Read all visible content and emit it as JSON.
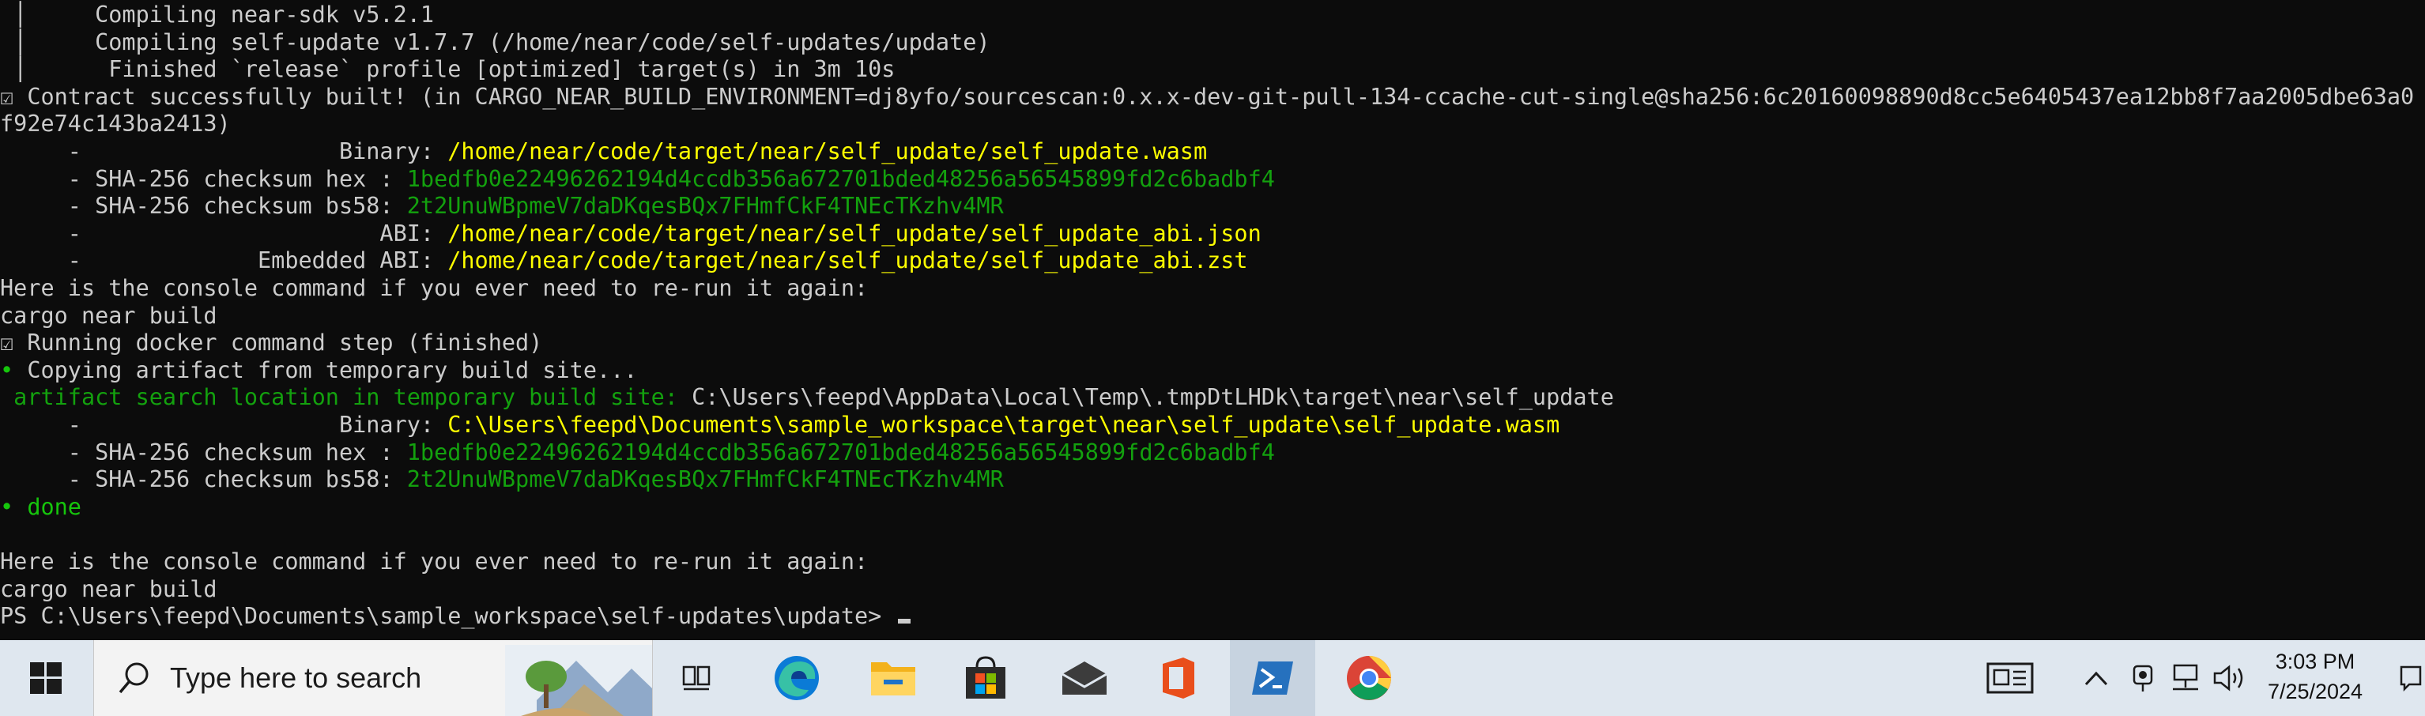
{
  "terminal": {
    "lines": [
      [
        {
          "t": " │     Compiling near-sdk v5.2.1",
          "c": "w"
        }
      ],
      [
        {
          "t": " │     Compiling self-update v1.7.7 (/home/near/code/self-updates/update)",
          "c": "w"
        }
      ],
      [
        {
          "t": " │      Finished `release` profile [optimized] target(s) in 3m 10s",
          "c": "w"
        }
      ],
      [
        {
          "t": "☑ Contract successfully built! (in CARGO_NEAR_BUILD_ENVIRONMENT=dj8yfo/sourcescan:0.x.x-dev-git-pull-134-ccache-cut-single@sha256:6c20160098890d8cc5e6405437ea12bb8f7aa2005dbe63a0",
          "c": "w"
        }
      ],
      [
        {
          "t": "f92e74c143ba2413)",
          "c": "w"
        }
      ],
      [
        {
          "t": "     -                   Binary: ",
          "c": "w"
        },
        {
          "t": "/home/near/code/target/near/self_update/self_update.wasm",
          "c": "y"
        }
      ],
      [
        {
          "t": "     - SHA-256 checksum hex : ",
          "c": "w"
        },
        {
          "t": "1bedfb0e22496262194d4ccdb356a672701bded48256a56545899fd2c6badbf4",
          "c": "dg"
        }
      ],
      [
        {
          "t": "     - SHA-256 checksum bs58: ",
          "c": "w"
        },
        {
          "t": "2t2UnuWBpmeV7daDKqesBQx7FHmfCkF4TNEcTKzhv4MR",
          "c": "dg"
        }
      ],
      [
        {
          "t": "     -                      ABI: ",
          "c": "w"
        },
        {
          "t": "/home/near/code/target/near/self_update/self_update_abi.json",
          "c": "y"
        }
      ],
      [
        {
          "t": "     -             Embedded ABI: ",
          "c": "w"
        },
        {
          "t": "/home/near/code/target/near/self_update/self_update_abi.zst",
          "c": "y"
        }
      ],
      [
        {
          "t": "Here is the console command if you ever need to re-run it again:",
          "c": "w"
        }
      ],
      [
        {
          "t": "cargo near build",
          "c": "w"
        }
      ],
      [
        {
          "t": "☑ Running docker command step (finished)",
          "c": "w"
        }
      ],
      [
        {
          "t": "•",
          "c": "g"
        },
        {
          "t": " Copying artifact from temporary build site...",
          "c": "w"
        }
      ],
      [
        {
          "t": " artifact search location in temporary build site: ",
          "c": "dg"
        },
        {
          "t": "C:\\Users\\feepd\\AppData\\Local\\Temp\\.tmpDtLHDk\\target\\near\\self_update",
          "c": "w"
        }
      ],
      [
        {
          "t": "     -                   Binary: ",
          "c": "w"
        },
        {
          "t": "C:\\Users\\feepd\\Documents\\sample_workspace\\target\\near\\self_update\\self_update.wasm",
          "c": "y"
        }
      ],
      [
        {
          "t": "     - SHA-256 checksum hex : ",
          "c": "w"
        },
        {
          "t": "1bedfb0e22496262194d4ccdb356a672701bded48256a56545899fd2c6badbf4",
          "c": "dg"
        }
      ],
      [
        {
          "t": "     - SHA-256 checksum bs58: ",
          "c": "w"
        },
        {
          "t": "2t2UnuWBpmeV7daDKqesBQx7FHmfCkF4TNEcTKzhv4MR",
          "c": "dg"
        }
      ],
      [
        {
          "t": "• done",
          "c": "g"
        }
      ],
      [
        {
          "t": "",
          "c": "w"
        }
      ],
      [
        {
          "t": "Here is the console command if you ever need to re-run it again:",
          "c": "w"
        }
      ],
      [
        {
          "t": "cargo near build",
          "c": "w"
        }
      ],
      [
        {
          "t": "PS C:\\Users\\feepd\\Documents\\sample_workspace\\self-updates\\update> ",
          "c": "w"
        }
      ]
    ]
  },
  "taskbar": {
    "search_placeholder": "Type here to search",
    "time": "3:03 PM",
    "date": "7/25/2024",
    "apps": [
      {
        "name": "task-view-icon"
      },
      {
        "name": "edge-icon"
      },
      {
        "name": "file-explorer-icon"
      },
      {
        "name": "microsoft-store-icon"
      },
      {
        "name": "mail-icon"
      },
      {
        "name": "office-icon"
      },
      {
        "name": "powershell-icon"
      },
      {
        "name": "chrome-icon"
      }
    ],
    "colors": {
      "accent": "#0078d4",
      "terminal_bg": "#0c0c0c",
      "path_yellow": "#fefe00",
      "hash_green": "#13a10e"
    }
  }
}
